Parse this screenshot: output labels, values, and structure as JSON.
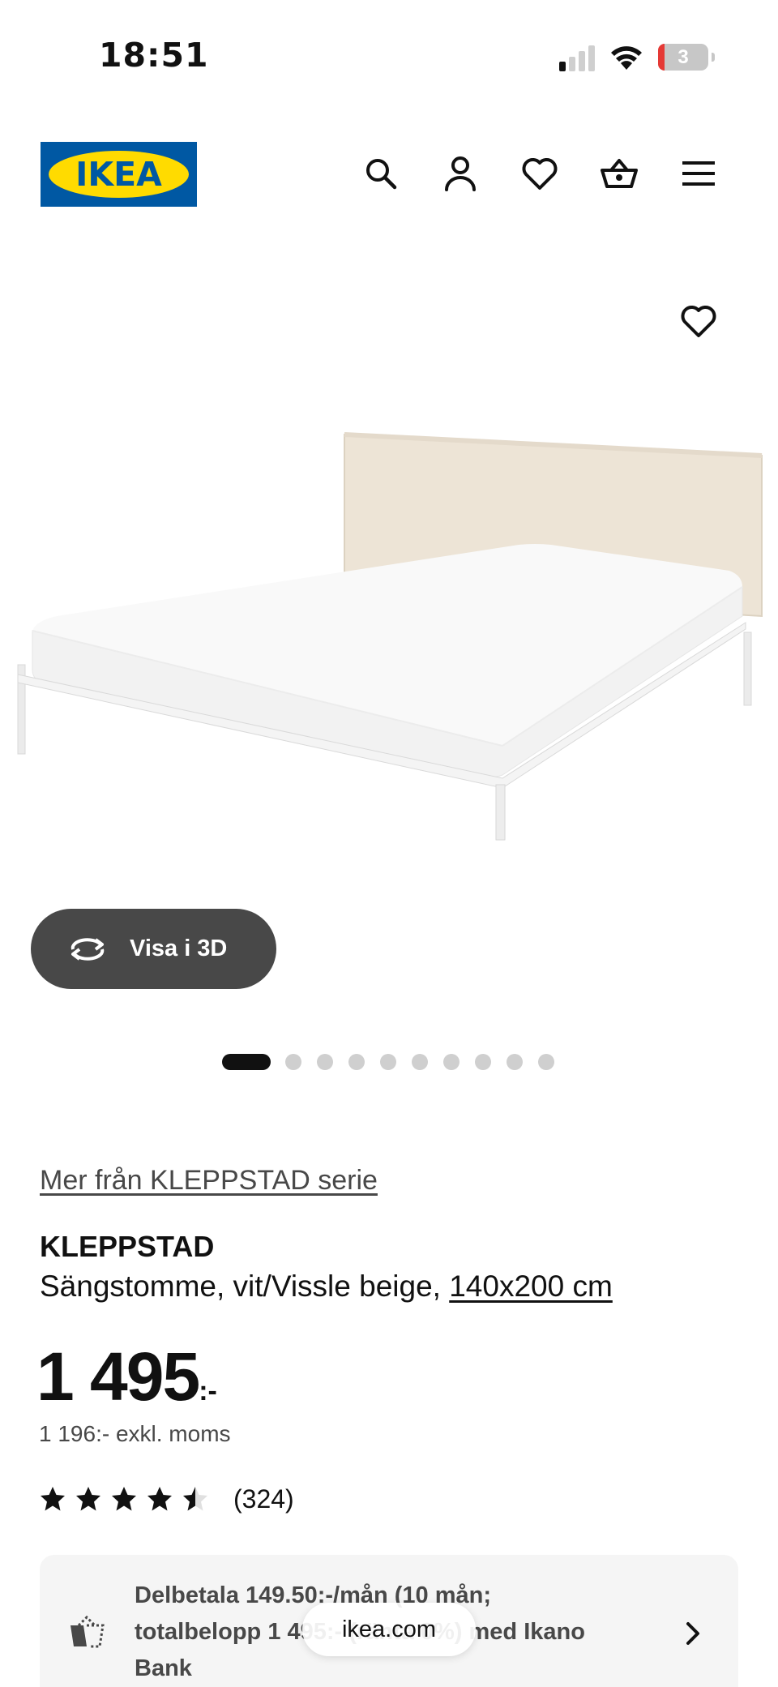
{
  "status_bar": {
    "time": "18:51",
    "battery_level": "3"
  },
  "header": {
    "logo_text": "IKEA",
    "icons": [
      "search-icon",
      "profile-icon",
      "heart-icon",
      "cart-icon",
      "menu-icon"
    ]
  },
  "gallery": {
    "view_3d_label": "Visa i 3D",
    "image_count": 10,
    "active_index": 0
  },
  "product": {
    "series_link": "Mer från KLEPPSTAD serie",
    "name": "KLEPPSTAD",
    "description": "Sängstomme, vit/Vissle beige, ",
    "size_link": "140x200 cm",
    "price_main": "1 495",
    "price_suffix": ":-",
    "price_excl_vat": "1 196:- exkl. moms",
    "rating": 4.5,
    "review_count": "(324)"
  },
  "financing": {
    "text": "Delbetala 149.50:-/mån (10 mån; totalbelopp 1 495:- (ränta 0%) med Ikano Bank"
  },
  "browser": {
    "url": "ikea.com"
  },
  "colors": {
    "brand_blue": "#0058a3",
    "brand_yellow": "#ffdb00",
    "button_dark": "#484848"
  }
}
